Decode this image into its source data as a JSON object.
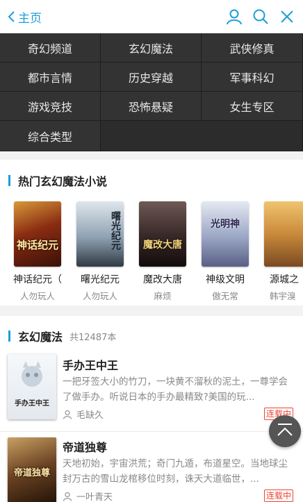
{
  "header": {
    "back_label": "主页"
  },
  "categories": [
    "奇幻频道",
    "玄幻魔法",
    "武侠修真",
    "都市言情",
    "历史穿越",
    "军事科幻",
    "游戏竞技",
    "恐怖悬疑",
    "女生专区",
    "综合类型"
  ],
  "hot": {
    "title": "热门玄幻魔法小说",
    "books": [
      {
        "title": "神话纪元（",
        "author": "人勿玩人",
        "cover_text": "神话纪元",
        "cover_color": "#7a2a12"
      },
      {
        "title": "曙光纪元",
        "author": "人勿玩人",
        "cover_text": "曙光纪元",
        "cover_color": "#8fa2b2"
      },
      {
        "title": "魔改大唐",
        "author": "麻烦",
        "cover_text": "魔改大唐",
        "cover_color": "#3a2b2a"
      },
      {
        "title": "神级文明",
        "author": "傲无常",
        "cover_text": "光明神",
        "cover_color": "#9aa6c4"
      },
      {
        "title": "源城之",
        "author": "韩宇溴",
        "cover_text": "",
        "cover_color": "#c98a3a"
      }
    ]
  },
  "section": {
    "title": "玄幻魔法",
    "count": "共12487本",
    "items": [
      {
        "title": "手办王中王",
        "desc": "一把牙签大小的竹刀，一块黄不溜秋的泥土，一尊学会了做手办。听说日本的手办最精致?美国的玩...",
        "author": "毛缺久",
        "badge": "连载中",
        "cover_text": "手办王中王",
        "cover_color": "#eef1f4"
      },
      {
        "title": "帝道独尊",
        "desc": "天地初始，宇宙洪荒；奇门九遁，布道星空。当地球尘封万古的雪山龙棺移位时刻，诛天大道临世，...",
        "author": "一叶青天",
        "badge": "连载中",
        "cover_text": "帝道独尊",
        "cover_color": "#5a3a22"
      }
    ]
  },
  "colors": {
    "accent": "#1a9fd8",
    "badge": "#e43333",
    "grid_bg": "#333333"
  }
}
